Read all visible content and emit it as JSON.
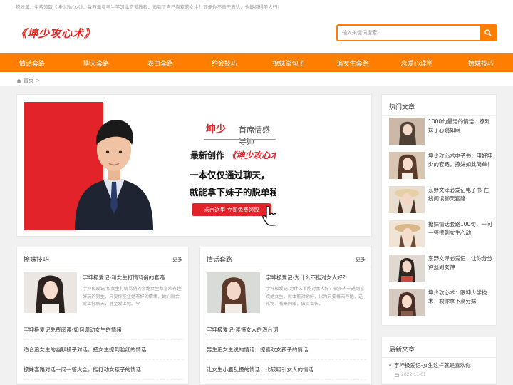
{
  "topbar": {
    "text": "抱脱单，免费领取《坤少攻心术》，数万单身男生学习此恋爱教程，追到了自己喜欢的女生！即便你不善于表达，也能拥得美人归！"
  },
  "header": {
    "logo": "《坤少攻心术》",
    "search_placeholder": "输入关键词搜索..."
  },
  "nav": [
    "情话套路",
    "聊天套路",
    "表白套路",
    "约会技巧",
    "撩妹掌句子",
    "追女生套路",
    "恋爱心理学",
    "撩妹技巧"
  ],
  "breadcrumb": {
    "home": "首页",
    "sep": ">"
  },
  "banner": {
    "name": "坤少",
    "role": "首席情感导师",
    "new_prefix": "最新创作",
    "book": "《坤少攻心术》",
    "line1": "一本仅仅通过聊天，",
    "line2": "就能拿下妹子的脱单秘籍！",
    "button": "点击这里  立即免费领取"
  },
  "hot": {
    "title": "热门文章",
    "items": [
      "1000句最污的情话，撩到妹子心跳如麻",
      "坤少攻心术电子书：用好坤少的套路，撩妹如此简单！",
      "东野文泽必爱记电子书-在线阅读聊天套路",
      "撩妹情话套路100句，一问一答撩到女生心动",
      "东野文泽必爱记：让你分分钟追到女神",
      "坤少攻心术：跟坤少学技术，教你拿下高分妹"
    ]
  },
  "latest": {
    "title": "最新文章",
    "item": "宇坤极爱记-女生这样就是喜欢你",
    "date": "2022-11-01"
  },
  "col_left": {
    "title": "撩妹技巧",
    "more": "更多",
    "feat_title": "宇坤极爱记-和女生打情骂俏的套路",
    "feat_desc": "宇坤极爱记-和女生打情骂俏的套路女生都喜欢有趣好玩的男生，只要你能让她有好的情绪，她们就会爱上你聊天，甚至爱上你。今",
    "items": [
      "宇坤极爱记免费阅读-如何调动女生的情绪！",
      "适合追女生的幽默段子对话，把女生撩到脸红的情话",
      "撩妹套路对话一问一答大全，能打动女孩子的情话"
    ]
  },
  "col_right": {
    "title": "情话套路",
    "more": "更多",
    "feat_title": "宇坤极爱记-为什么不能对女人好?",
    "feat_desc": "宇坤极爱记-为什么不能对女人好？很多人一遇到喜欢她女生，就本能对她好，以为只要每天夸她，送礼物，嘘寒问暖，做买单侠，",
    "items": [
      "宇坤极爱记-读懂女人的潜台词",
      "男生追女生说的情话，撩喜欢女孩子的情话",
      "让女生小鹿乱撞的情话，比较吸引女人的情话"
    ]
  },
  "colors": {
    "accent": "#ff7e00",
    "red": "#e3232a"
  }
}
